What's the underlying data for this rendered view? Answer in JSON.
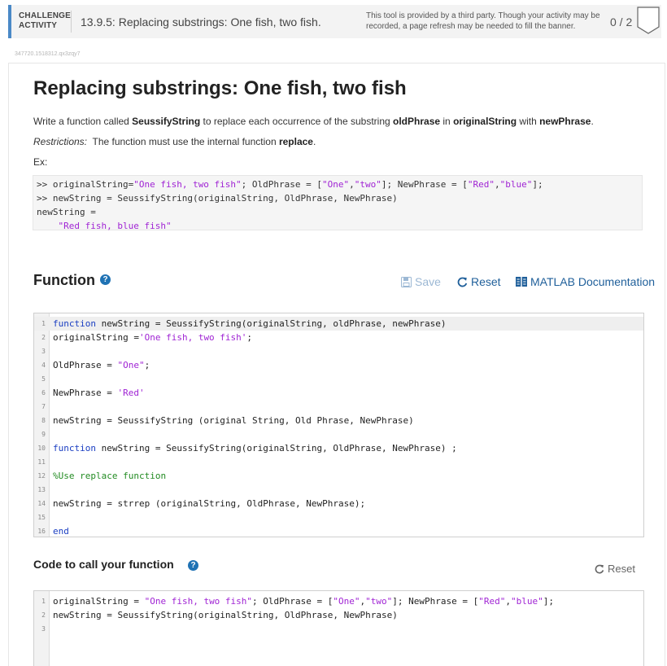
{
  "header": {
    "activity_label_line1": "CHALLENGE",
    "activity_label_line2": "ACTIVITY",
    "title": "13.9.5: Replacing substrings: One fish, two fish.",
    "third_party_note": "This tool is provided by a third party. Though your activity may be recorded, a page refresh may be needed to fill the banner.",
    "progress": "0 / 2"
  },
  "activity_id": "347720.1518312.qx3zqy7",
  "page_title": "Replacing substrings: One fish, two fish",
  "description": {
    "p1_a": "Write a function called ",
    "p1_b": "SeussifyString",
    "p1_c": " to replace each occurrence of the substring ",
    "p1_d": "oldPhrase",
    "p1_e": " in ",
    "p1_f": "originalString",
    "p1_g": " with ",
    "p1_h": "newPhrase",
    "p1_i": ".",
    "p2_a": "Restrictions:",
    "p2_b": "  The function must use the internal function ",
    "p2_c": "replace",
    "p2_d": ".",
    "p3": "Ex:"
  },
  "example": {
    "l1_a": ">> originalString=",
    "l1_b": "\"One fish, two fish\"",
    "l1_c": "; OldPhrase = [",
    "l1_d": "\"One\"",
    "l1_e": ",",
    "l1_f": "\"two\"",
    "l1_g": "]; NewPhrase = [",
    "l1_h": "\"Red\"",
    "l1_i": ",",
    "l1_j": "\"blue\"",
    "l1_k": "];",
    "l2": ">> newString = SeussifyString(originalString, OldPhrase, NewPhrase)",
    "l3": "newString = ",
    "l4": "    \"Red fish, blue fish\""
  },
  "function_section": {
    "title": "Function",
    "help_icon": "?",
    "save_label": "Save",
    "reset_label": "Reset",
    "doc_label": "MATLAB Documentation",
    "line_numbers": [
      "1",
      "2",
      "3",
      "4",
      "5",
      "6",
      "7",
      "8",
      "9",
      "10",
      "11",
      "12",
      "13",
      "14",
      "15",
      "16"
    ],
    "code": {
      "l1_kw": "function",
      "l1_rest": " newString = SeussifyString(originalString, oldPhrase, newPhrase)",
      "l2_a": "originalString =",
      "l2_b": "'One fish, two fish'",
      "l2_c": ";",
      "l4_a": "OldPhrase = ",
      "l4_b": "\"One\"",
      "l4_c": ";",
      "l6_a": "NewPhrase = ",
      "l6_b": "'Red'",
      "l8": "newString = SeussifyString (original String, Old Phrase, NewPhrase)",
      "l10_kw": "function",
      "l10_rest": " newString = SeussifyString(originalString, OldPhrase, NewPhrase) ;",
      "l12": "%Use replace function",
      "l14": "newString = strrep (originalString, OldPhrase, NewPhrase);",
      "l16": "end"
    }
  },
  "call_section": {
    "title": "Code to call your function",
    "help_icon": "?",
    "reset_label": "Reset",
    "line_numbers": [
      "1",
      "2",
      "3"
    ],
    "code": {
      "l1_a": "originalString = ",
      "l1_b": "\"One fish, two fish\"",
      "l1_c": "; OldPhrase = [",
      "l1_d": "\"One\"",
      "l1_e": ",",
      "l1_f": "\"two\"",
      "l1_g": "]; NewPhrase = [",
      "l1_h": "\"Red\"",
      "l1_i": ",",
      "l1_j": "\"blue\"",
      "l1_k": "];",
      "l2": "newString = SeussifyString(originalString, OldPhrase, NewPhrase)"
    }
  },
  "colors": {
    "accent": "#4a89c7",
    "link": "#1f5f9a",
    "string": "#a024d4",
    "keyword": "#1a3ec2",
    "comment": "#228b22"
  }
}
